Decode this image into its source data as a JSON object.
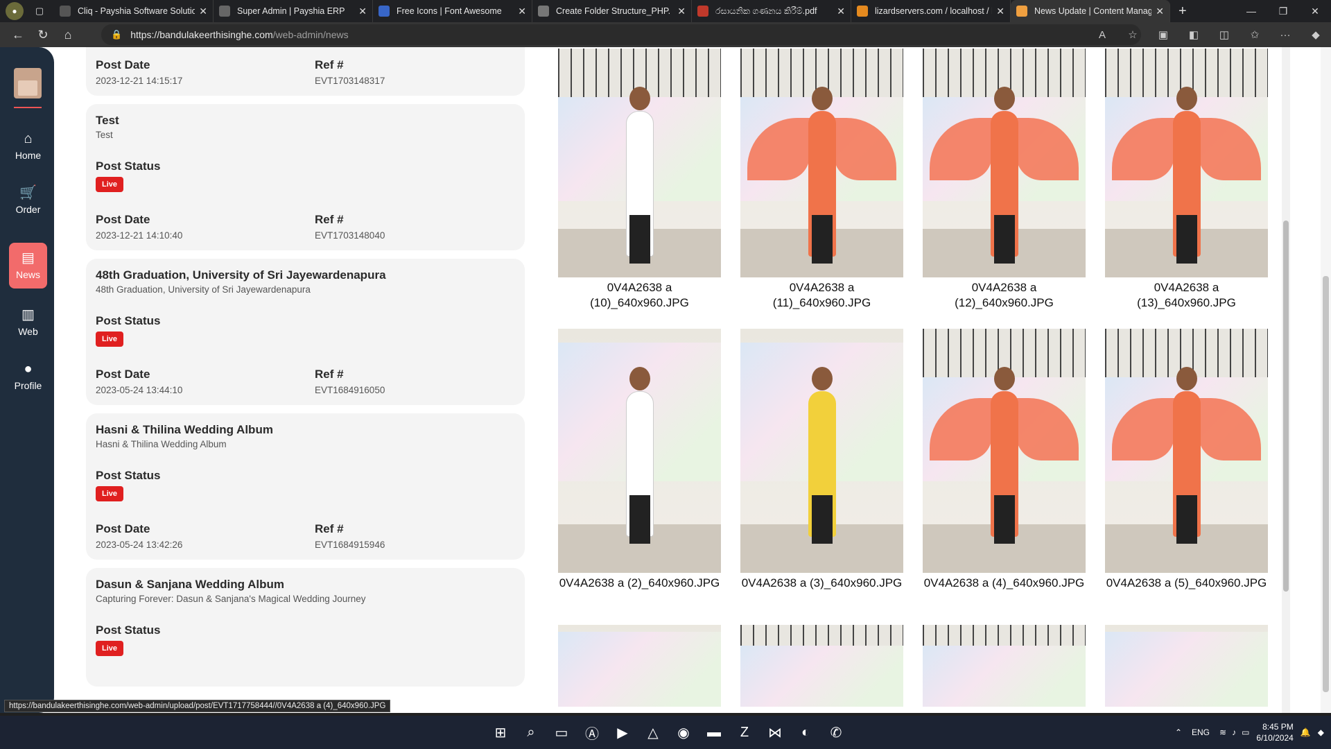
{
  "browser": {
    "tabs": [
      {
        "title": "Cliq - Payshia Software Solution",
        "color": "#555"
      },
      {
        "title": "Super Admin | Payshia ERP",
        "color": "#666"
      },
      {
        "title": "Free Icons | Font Awesome",
        "color": "#3866c7"
      },
      {
        "title": "Create Folder Structure_PHP.",
        "color": "#777"
      },
      {
        "title": "රසායනික ගණනය කිරීම්.pdf",
        "color": "#c0392b"
      },
      {
        "title": "lizardservers.com / localhost / l",
        "color": "#e58a1f"
      },
      {
        "title": "News Update | Content Manag",
        "color": "#f0a040"
      }
    ],
    "url_domain": "https://bandulakeerthisinghe.com",
    "url_path": "/web-admin/news",
    "status_url": "https://bandulakeerthisinghe.com/web-admin/upload/post/EVT1717758444//0V4A2638 a (4)_640x960.JPG"
  },
  "sidebar": {
    "items": [
      {
        "label": "Home",
        "icon": "home-icon"
      },
      {
        "label": "Order",
        "icon": "cart-icon"
      },
      {
        "label": "News",
        "icon": "news-icon",
        "active": true
      },
      {
        "label": "Web",
        "icon": "web-icon"
      },
      {
        "label": "Profile",
        "icon": "profile-icon"
      }
    ]
  },
  "posts": {
    "labels": {
      "status": "Post Status",
      "date": "Post Date",
      "ref": "Ref #",
      "live": "Live"
    },
    "items": [
      {
        "title": "Test",
        "subtitle": "Test",
        "date": "2023-12-21 14:10:40",
        "ref": "EVT1703148040"
      },
      {
        "title": "48th Graduation, University of Sri Jayewardenapura",
        "subtitle": "48th Graduation, University of Sri Jayewardenapura",
        "date": "2023-05-24 13:44:10",
        "ref": "EVT1684916050"
      },
      {
        "title": "Hasni & Thilina Wedding Album",
        "subtitle": "Hasni & Thilina Wedding Album",
        "date": "2023-05-24 13:42:26",
        "ref": "EVT1684915946"
      },
      {
        "title": "Dasun & Sanjana Wedding Album",
        "subtitle": "Capturing Forever: Dasun & Sanjana's Magical Wedding Journey"
      }
    ],
    "top_partial": {
      "date": "2023-12-21 14:15:17",
      "ref": "EVT1703148317"
    }
  },
  "gallery": {
    "captions": [
      "0V4A2638 a (10)_640x960.JPG",
      "0V4A2638 a (11)_640x960.JPG",
      "0V4A2638 a (12)_640x960.JPG",
      "0V4A2638 a (13)_640x960.JPG",
      "0V4A2638 a (2)_640x960.JPG",
      "0V4A2638 a (3)_640x960.JPG",
      "0V4A2638 a (4)_640x960.JPG",
      "0V4A2638 a (5)_640x960.JPG"
    ]
  },
  "taskbar": {
    "lang": "ENG",
    "time": "8:45 PM",
    "date": "6/10/2024"
  }
}
